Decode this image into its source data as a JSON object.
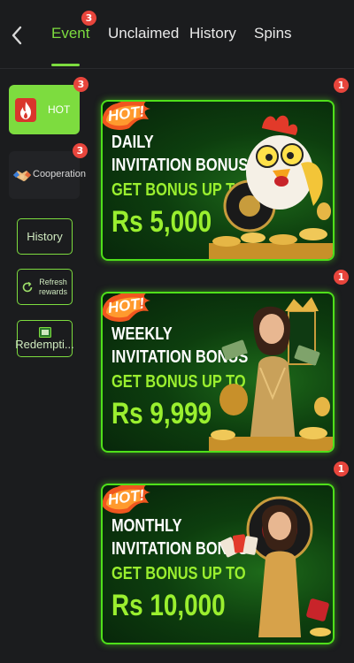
{
  "nav": {
    "tabs": [
      {
        "label": "Event",
        "badge": "3",
        "active": true
      },
      {
        "label": "Unclaimed"
      },
      {
        "label": "History"
      },
      {
        "label": "Spins"
      }
    ]
  },
  "sidebar": {
    "categories": [
      {
        "label": "HOT",
        "badge": "3",
        "active": true
      },
      {
        "label": "Cooperation",
        "badge": "3"
      }
    ],
    "buttons": [
      {
        "label": "History"
      },
      {
        "label": "Refresh\nrewards"
      },
      {
        "label": "Redempti..."
      }
    ]
  },
  "banners": [
    {
      "hot": "HOT!",
      "title": "DAILY",
      "subtitle": "INVITATION BONUS",
      "get_bonus": "GET BONUS UP TO",
      "amount": "Rs 5,000",
      "badge": "1"
    },
    {
      "hot": "HOT!",
      "title": "WEEKLY",
      "subtitle": "INVITATION BONUS",
      "get_bonus": "GET BONUS UP TO",
      "amount": "Rs 9,999",
      "badge": "1"
    },
    {
      "hot": "HOT!",
      "title": "MONTHLY",
      "subtitle": "INVITATION BONUS",
      "get_bonus": "GET BONUS UP TO",
      "amount": "Rs 10,000",
      "badge": "1"
    }
  ],
  "colors": {
    "accent": "#7ddc3f",
    "badge": "#e8453c",
    "background": "#1b1c1e"
  }
}
